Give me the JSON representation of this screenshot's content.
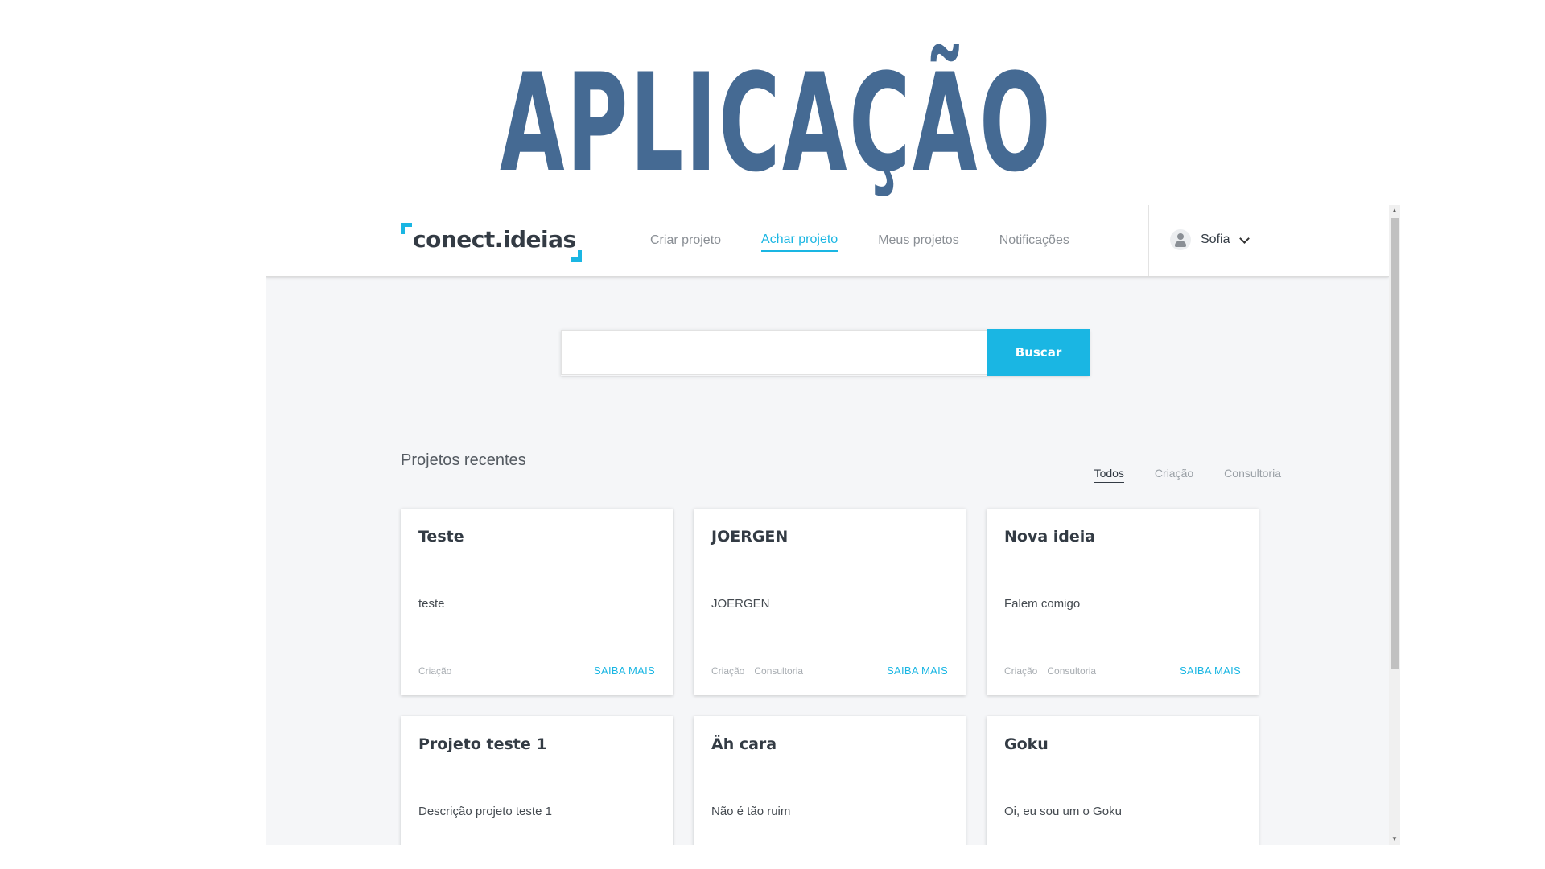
{
  "slide": {
    "title": "APLICAÇÃO"
  },
  "app": {
    "logo": {
      "text": "conect.ideias"
    },
    "nav": [
      {
        "label": "Criar projeto",
        "active": false
      },
      {
        "label": "Achar projeto",
        "active": true
      },
      {
        "label": "Meus projetos",
        "active": false
      },
      {
        "label": "Notificações",
        "active": false
      }
    ],
    "user": {
      "name": "Sofia",
      "icon": "user-icon",
      "menu_icon": "chevron-down-icon"
    },
    "search": {
      "placeholder": "",
      "value": "",
      "button_label": "Buscar"
    },
    "recent": {
      "title": "Projetos recentes",
      "filters": [
        {
          "label": "Todos",
          "active": true
        },
        {
          "label": "Criação",
          "active": false
        },
        {
          "label": "Consultoria",
          "active": false
        }
      ],
      "cards": [
        {
          "title": "Teste",
          "description": "teste",
          "tags": [
            "Criação"
          ],
          "more_label": "SAIBA MAIS"
        },
        {
          "title": "JOERGEN",
          "description": "JOERGEN",
          "tags": [
            "Criação",
            "Consultoria"
          ],
          "more_label": "SAIBA MAIS"
        },
        {
          "title": "Nova ideia",
          "description": "Falem comigo",
          "tags": [
            "Criação",
            "Consultoria"
          ],
          "more_label": "SAIBA MAIS"
        },
        {
          "title": "Projeto teste 1",
          "description": "Descrição projeto teste 1",
          "tags": [],
          "more_label": ""
        },
        {
          "title": "Äh cara",
          "description": "Não é tão ruim",
          "tags": [],
          "more_label": ""
        },
        {
          "title": "Goku",
          "description": "Oi, eu sou um o Goku",
          "tags": [],
          "more_label": ""
        }
      ]
    },
    "colors": {
      "accent": "#1ab6e3",
      "title": "#456a93",
      "background": "#f5f6f8"
    }
  }
}
